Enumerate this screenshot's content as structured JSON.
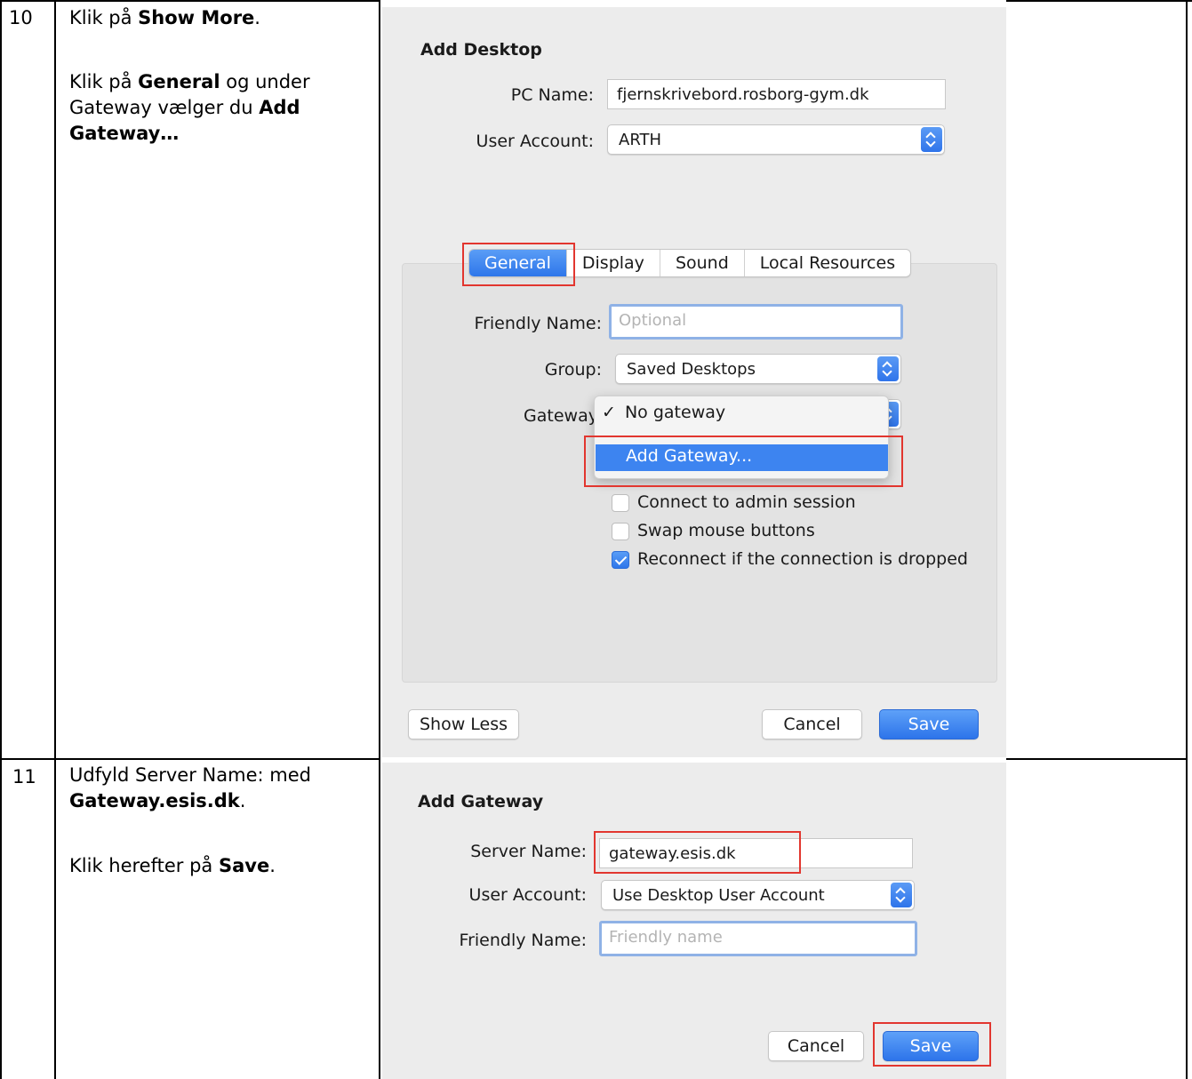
{
  "steps": [
    {
      "number": "10",
      "line1": {
        "prefix": "Klik på ",
        "bold": "Show More",
        "suffix": "."
      },
      "line2": {
        "prefix": "Klik på ",
        "bold1": "General",
        "mid1": " og under",
        "mid2": "Gateway vælger du ",
        "bold2": "Add",
        "bold3": "Gateway…"
      }
    },
    {
      "number": "11",
      "line1": {
        "prefix": "Udfyld Server Name: med",
        "bold": "Gateway.esis.dk",
        "suffix": "."
      },
      "line2": {
        "prefix": "Klik herefter på ",
        "bold": "Save",
        "suffix": "."
      }
    }
  ],
  "add_desktop": {
    "title": "Add Desktop",
    "pc_name_label": "PC Name:",
    "pc_name_value": "fjernskrivebord.rosborg-gym.dk",
    "user_account_label": "User Account:",
    "user_account_value": "ARTH",
    "tabs": [
      "General",
      "Display",
      "Sound",
      "Local Resources"
    ],
    "active_tab": "General",
    "friendly_name_label": "Friendly Name:",
    "friendly_name_placeholder": "Optional",
    "group_label": "Group:",
    "group_value": "Saved Desktops",
    "gateway_label": "Gateway:",
    "gateway_menu": {
      "checkmark": "✓",
      "items": [
        "No gateway",
        "Add Gateway..."
      ],
      "checked_item": "No gateway",
      "highlighted_item": "Add Gateway..."
    },
    "checkboxes": [
      {
        "label": "Connect to admin session",
        "checked": false
      },
      {
        "label": "Swap mouse buttons",
        "checked": false
      },
      {
        "label": "Reconnect if the connection is dropped",
        "checked": true
      }
    ],
    "buttons": {
      "show_less": "Show Less",
      "cancel": "Cancel",
      "save": "Save"
    }
  },
  "add_gateway": {
    "title": "Add Gateway",
    "server_name_label": "Server Name:",
    "server_name_value": "gateway.esis.dk",
    "user_account_label": "User Account:",
    "user_account_value": "Use Desktop User Account",
    "friendly_name_label": "Friendly Name:",
    "friendly_name_placeholder": "Friendly name",
    "buttons": {
      "cancel": "Cancel",
      "save": "Save"
    }
  },
  "colors": {
    "accent": "#3d84f0",
    "highlight_box": "#e2362f",
    "panel_bg": "#ececec"
  }
}
